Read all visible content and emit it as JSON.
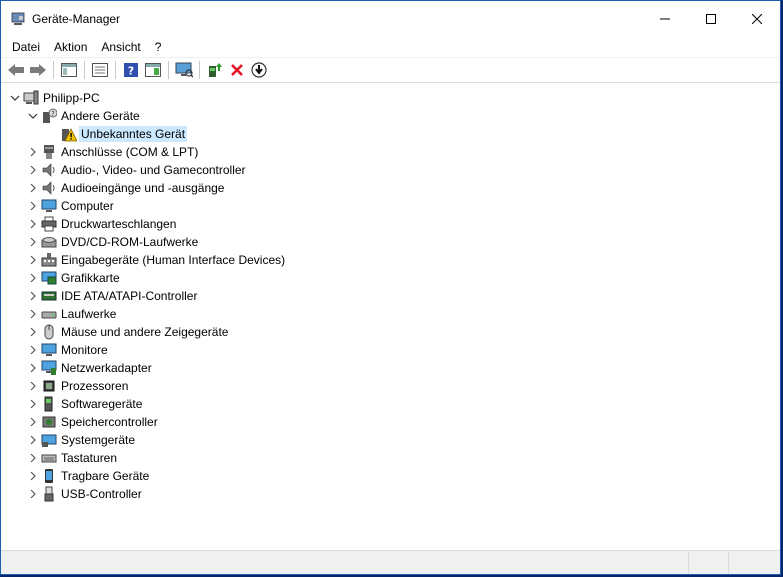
{
  "window": {
    "title": "Geräte-Manager"
  },
  "menu": [
    "Datei",
    "Aktion",
    "Ansicht",
    "?"
  ],
  "toolbar": {
    "buttons": [
      "back-arrow-icon",
      "forward-arrow-icon",
      "properties-pane-icon",
      "list-view-icon",
      "help-icon",
      "show-details-icon",
      "monitor-scan-icon",
      "update-driver-icon",
      "uninstall-x-icon",
      "download-circle-icon"
    ]
  },
  "tree": {
    "root": "Philipp-PC",
    "open_group": {
      "label": "Andere Geräte",
      "child": "Unbekanntes Gerät"
    },
    "categories": [
      "Anschlüsse (COM & LPT)",
      "Audio-, Video- und Gamecontroller",
      "Audioeingänge und -ausgänge",
      "Computer",
      "Druckwarteschlangen",
      "DVD/CD-ROM-Laufwerke",
      "Eingabegeräte (Human Interface Devices)",
      "Grafikkarte",
      "IDE ATA/ATAPI-Controller",
      "Laufwerke",
      "Mäuse und andere Zeigegeräte",
      "Monitore",
      "Netzwerkadapter",
      "Prozessoren",
      "Softwaregeräte",
      "Speichercontroller",
      "Systemgeräte",
      "Tastaturen",
      "Tragbare Geräte",
      "USB-Controller"
    ]
  },
  "colors": {
    "accent": "#1a5fb4",
    "selection": "#cce8ff",
    "warning": "#f2c200",
    "delete": "#e81123"
  }
}
